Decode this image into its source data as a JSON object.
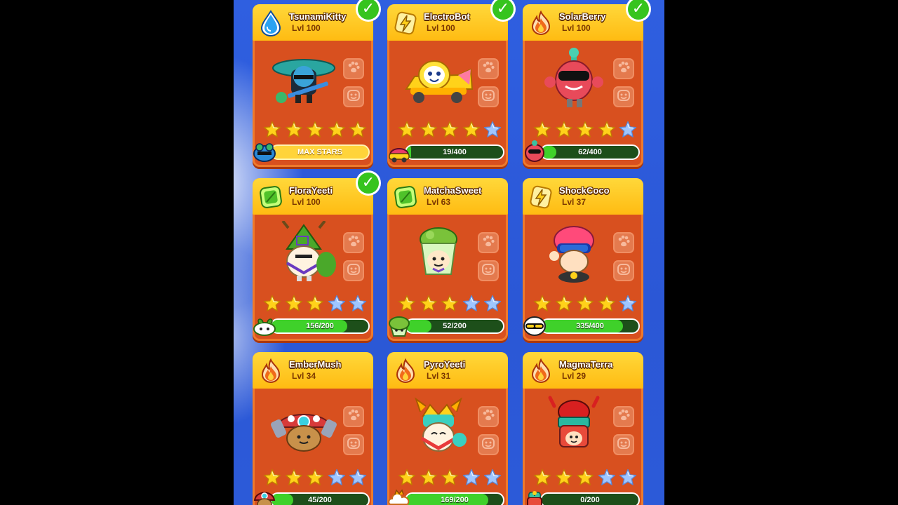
{
  "colors": {
    "card_bg": "#d8501f",
    "header_yellow": "#ffc81f",
    "progress_green": "#3fd12a",
    "progress_track": "#1d4f1a",
    "star_gold": "#ffd21a",
    "star_blue": "#9fc6ff",
    "check_green": "#36c41e",
    "background_blue": "#2f5fe0"
  },
  "cards": [
    {
      "name": "TsunamiKitty",
      "level": "Lvl 100",
      "element": "water-drop-icon",
      "checked": true,
      "gold_stars": 5,
      "total_stars": 5,
      "progress_label": "MAX STARS",
      "progress_fraction": 1.0,
      "max": true,
      "art": "tsunami-kitty-figure",
      "badge": "frog-badge-icon"
    },
    {
      "name": "ElectroBot",
      "level": "Lvl 100",
      "element": "lightning-icon",
      "checked": true,
      "gold_stars": 4,
      "total_stars": 5,
      "progress_label": "19/400",
      "progress_fraction": 0.0475,
      "max": false,
      "art": "electro-bot-figure",
      "badge": "car-badge-icon"
    },
    {
      "name": "SolarBerry",
      "level": "Lvl 100",
      "element": "fire-icon",
      "checked": true,
      "gold_stars": 4,
      "total_stars": 5,
      "progress_label": "62/400",
      "progress_fraction": 0.155,
      "max": false,
      "art": "solar-berry-figure",
      "badge": "berry-badge-icon"
    },
    {
      "name": "FloraYeeti",
      "level": "Lvl 100",
      "element": "leaf-icon",
      "checked": true,
      "gold_stars": 3,
      "total_stars": 5,
      "progress_label": "156/200",
      "progress_fraction": 0.78,
      "max": false,
      "art": "flora-yeeti-figure",
      "badge": "sprout-badge-icon"
    },
    {
      "name": "MatchaSweet",
      "level": "Lvl 63",
      "element": "leaf-icon",
      "checked": false,
      "gold_stars": 3,
      "total_stars": 5,
      "progress_label": "52/200",
      "progress_fraction": 0.26,
      "max": false,
      "art": "matcha-sweet-figure",
      "badge": "cupcake-badge-icon"
    },
    {
      "name": "ShockCoco",
      "level": "Lvl 37",
      "element": "lightning-icon",
      "checked": false,
      "gold_stars": 4,
      "total_stars": 5,
      "progress_label": "335/400",
      "progress_fraction": 0.8375,
      "max": false,
      "art": "shock-coco-figure",
      "badge": "helmet-badge-icon"
    },
    {
      "name": "EmberMush",
      "level": "Lvl 34",
      "element": "fire-icon",
      "checked": false,
      "gold_stars": 3,
      "total_stars": 5,
      "progress_label": "45/200",
      "progress_fraction": 0.225,
      "max": false,
      "art": "ember-mush-figure",
      "badge": "mushroom-badge-icon"
    },
    {
      "name": "PyroYeeti",
      "level": "Lvl 31",
      "element": "fire-icon",
      "checked": false,
      "gold_stars": 3,
      "total_stars": 5,
      "progress_label": "169/200",
      "progress_fraction": 0.845,
      "max": false,
      "art": "pyro-yeeti-figure",
      "badge": "cloud-badge-icon"
    },
    {
      "name": "MagmaTerra",
      "level": "Lvl 29",
      "element": "fire-icon",
      "checked": false,
      "gold_stars": 3,
      "total_stars": 5,
      "progress_label": "0/200",
      "progress_fraction": 0.0,
      "max": false,
      "art": "magma-terra-figure",
      "badge": "plant-badge-icon"
    }
  ]
}
